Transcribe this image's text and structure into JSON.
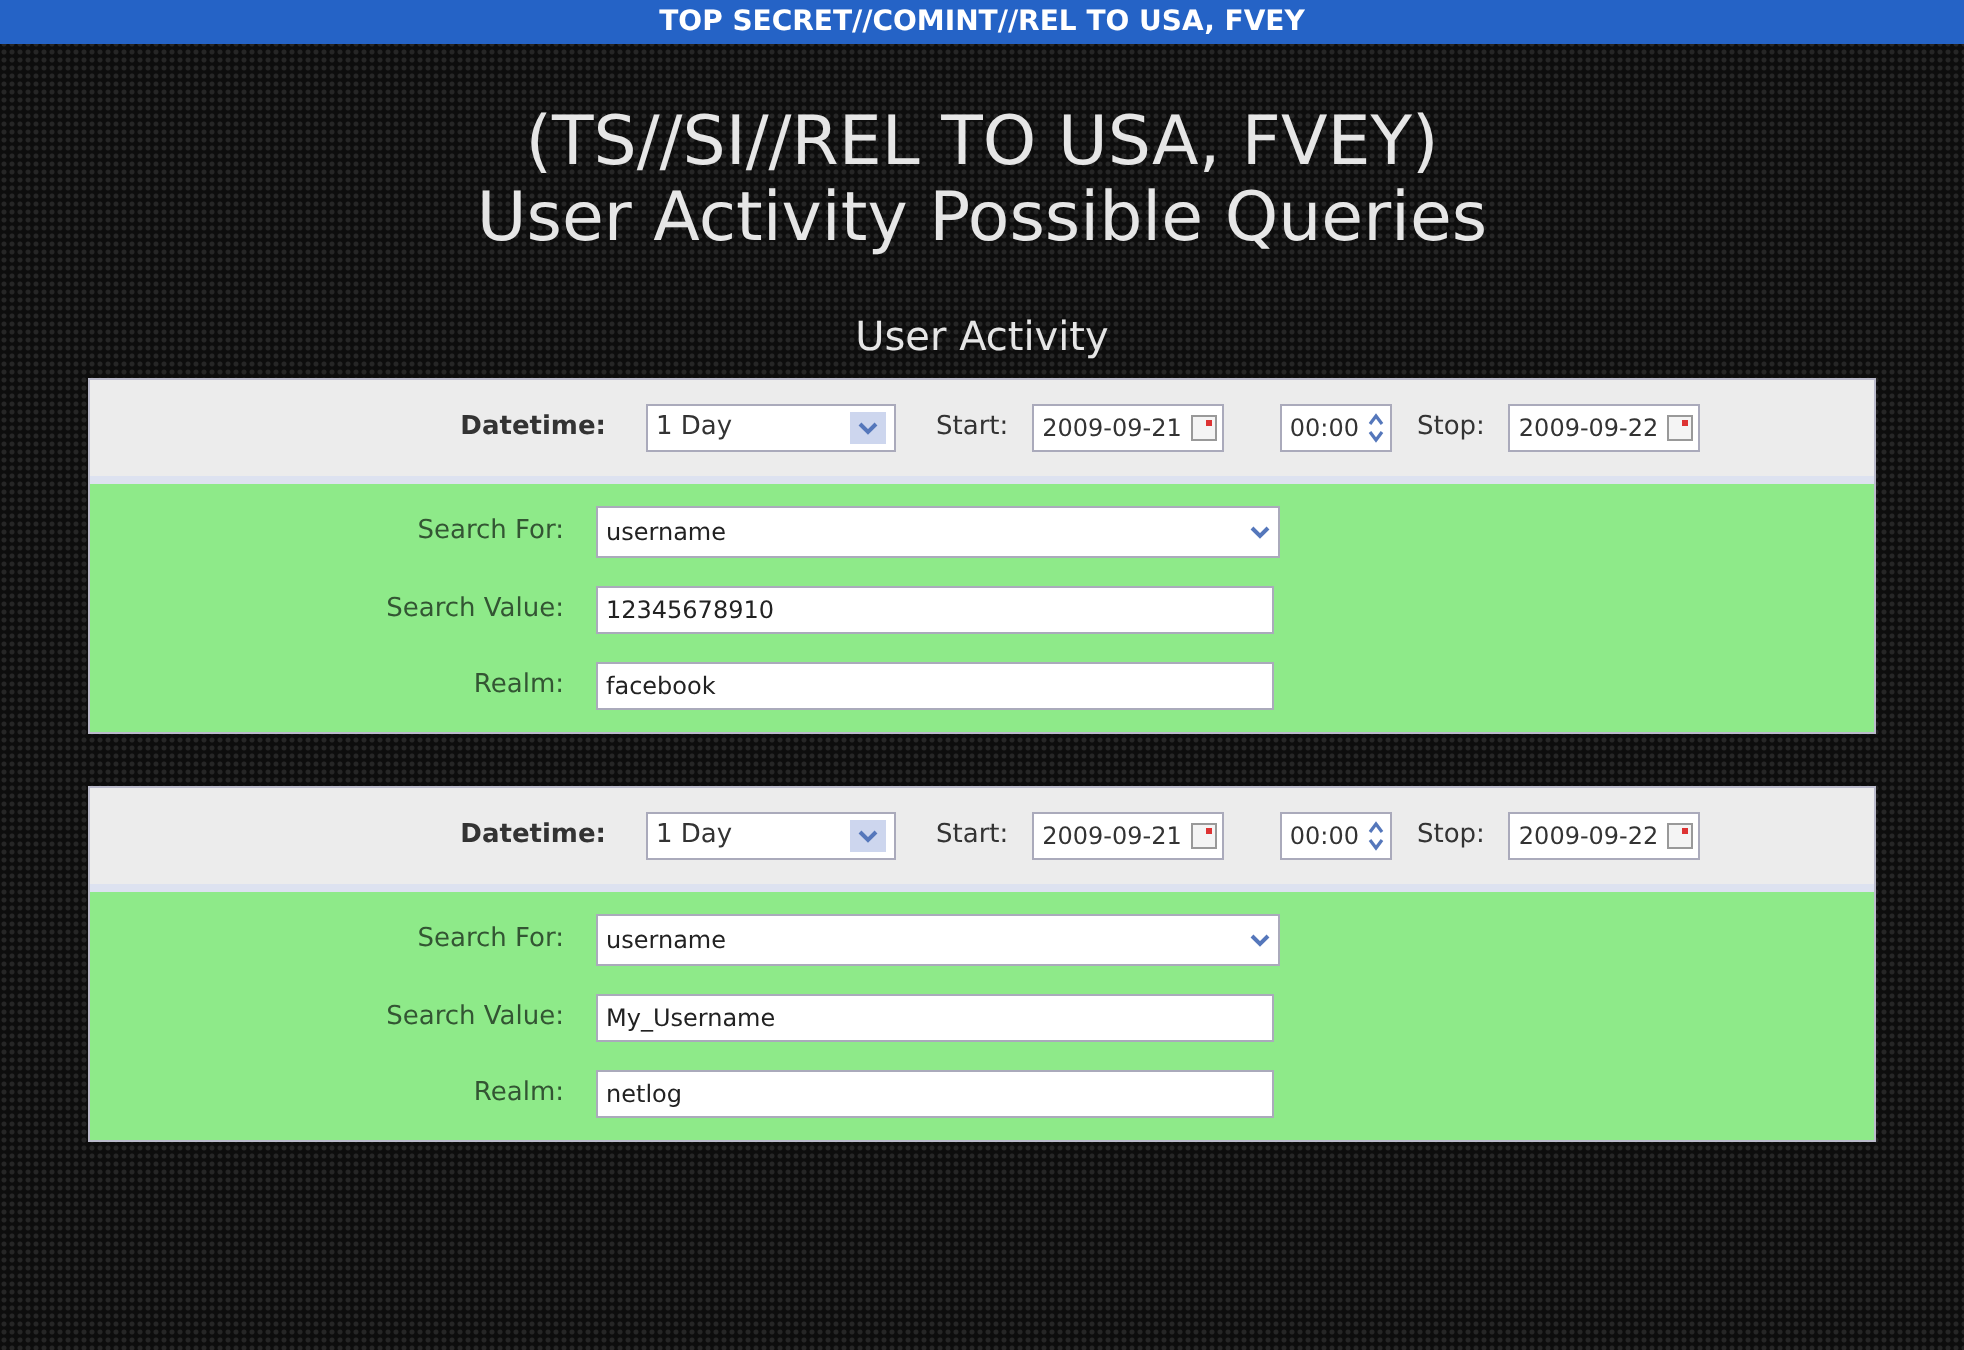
{
  "banner": "TOP SECRET//COMINT//REL TO USA, FVEY",
  "title_lines": [
    "(TS//SI//REL TO USA, FVEY)",
    "User Activity Possible Queries"
  ],
  "section_title": "User Activity",
  "panels": [
    {
      "datetime_label": "Datetime:",
      "range": "1 Day",
      "start_label": "Start:",
      "start": "2009-09-21",
      "time": "00:00",
      "stop_label": "Stop:",
      "stop": "2009-09-22",
      "fields": [
        {
          "kind": "select",
          "label": "Search For:",
          "value": "username"
        },
        {
          "kind": "text",
          "label": "Search Value:",
          "value": "12345678910"
        },
        {
          "kind": "text",
          "label": "Realm:",
          "value": "facebook"
        }
      ]
    },
    {
      "datetime_label": "Datetime:",
      "range": "1 Day",
      "start_label": "Start:",
      "start": "2009-09-21",
      "time": "00:00",
      "stop_label": "Stop:",
      "stop": "2009-09-22",
      "fields": [
        {
          "kind": "select",
          "label": "Search For:",
          "value": "username"
        },
        {
          "kind": "text",
          "label": "Search Value:",
          "value": "My_Username"
        },
        {
          "kind": "text",
          "label": "Realm:",
          "value": "netlog"
        }
      ]
    }
  ]
}
